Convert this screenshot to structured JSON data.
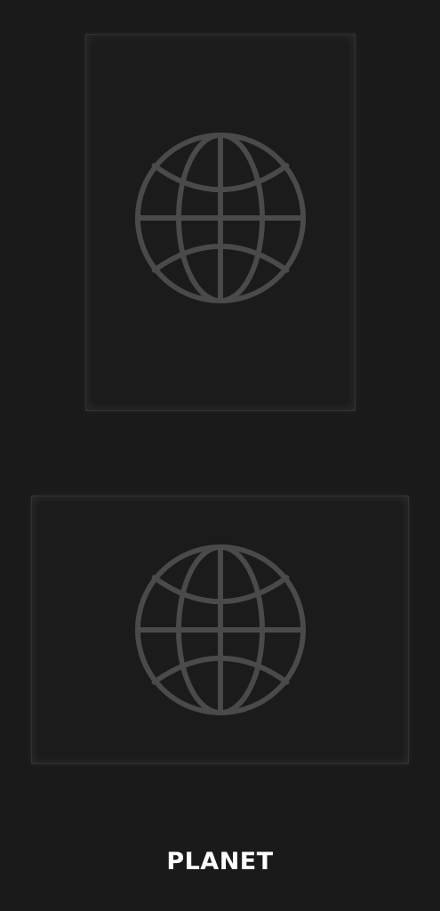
{
  "items": [
    {
      "kind": "portrait-frame",
      "icon": "globe-icon"
    },
    {
      "kind": "landscape-frame",
      "icon": "globe-icon"
    }
  ],
  "brand": {
    "label": "PLANET"
  },
  "colors": {
    "background": "#1a1a1a",
    "card_background": "#1b1b1b",
    "icon_stroke": "#4a4a4a",
    "brand_text": "#ffffff"
  }
}
